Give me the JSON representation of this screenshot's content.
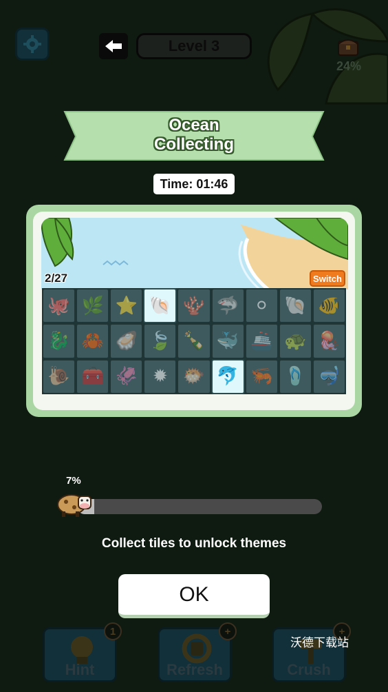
{
  "header": {
    "level_label": "Level 3",
    "chest_percent": "24%"
  },
  "modal": {
    "title_line1": "Ocean",
    "title_line2": "Collecting",
    "timer": "Time: 01:46",
    "collected_count": "2/27",
    "switch_label": "Switch",
    "tiles": [
      {
        "icon": "octopus-icon",
        "glyph": "🐙",
        "collected": false
      },
      {
        "icon": "seaweed-icon",
        "glyph": "🌿",
        "collected": false
      },
      {
        "icon": "starfish-icon",
        "glyph": "⭐",
        "collected": false
      },
      {
        "icon": "scallop-shell-icon",
        "glyph": "🐚",
        "collected": true
      },
      {
        "icon": "coral-icon",
        "glyph": "🪸",
        "collected": false
      },
      {
        "icon": "manta-ray-icon",
        "glyph": "🦈",
        "collected": false
      },
      {
        "icon": "pearl-icon",
        "glyph": "⚪",
        "collected": false
      },
      {
        "icon": "conch-shell-icon",
        "glyph": "🐚",
        "collected": false
      },
      {
        "icon": "clownfish-icon",
        "glyph": "🐠",
        "collected": false
      },
      {
        "icon": "seahorse-icon",
        "glyph": "🐉",
        "collected": false
      },
      {
        "icon": "crab-icon",
        "glyph": "🦀",
        "collected": false
      },
      {
        "icon": "oyster-pearl-icon",
        "glyph": "🦪",
        "collected": false
      },
      {
        "icon": "sea-glass-icon",
        "glyph": "🍃",
        "collected": false
      },
      {
        "icon": "message-bottle-icon",
        "glyph": "🍾",
        "collected": false
      },
      {
        "icon": "whale-icon",
        "glyph": "🐳",
        "collected": false
      },
      {
        "icon": "submarine-icon",
        "glyph": "🚢",
        "collected": false
      },
      {
        "icon": "turtle-icon",
        "glyph": "🐢",
        "collected": false
      },
      {
        "icon": "jellyfish-icon",
        "glyph": "🪼",
        "collected": false
      },
      {
        "icon": "hermit-crab-icon",
        "glyph": "🐌",
        "collected": false
      },
      {
        "icon": "treasure-chest-icon",
        "glyph": "🧰",
        "collected": false
      },
      {
        "icon": "squid-icon",
        "glyph": "🦑",
        "collected": false
      },
      {
        "icon": "sea-urchin-icon",
        "glyph": "✹",
        "collected": false
      },
      {
        "icon": "pufferfish-icon",
        "glyph": "🐡",
        "collected": false
      },
      {
        "icon": "dolphin-icon",
        "glyph": "🐬",
        "collected": true
      },
      {
        "icon": "shrimp-icon",
        "glyph": "🦐",
        "collected": false
      },
      {
        "icon": "flipper-icon",
        "glyph": "🩴",
        "collected": false
      },
      {
        "icon": "snorkel-mask-icon",
        "glyph": "🤿",
        "collected": false
      }
    ],
    "progress_percent_label": "7%",
    "progress_fraction": 0.07,
    "message": "Collect tiles to unlock themes",
    "ok_label": "OK"
  },
  "bottom_bar": {
    "hint_label": "Hint",
    "hint_count": "1",
    "refresh_label": "Refresh",
    "crush_label": "Crush",
    "add_symbol": "+"
  },
  "watermark": "沃德下载站",
  "colors": {
    "ribbon": "#b5e0ae",
    "card": "#a9d6a2",
    "switch": "#f07a1e",
    "tile_locked": "#3e5a5e",
    "tile_collected": "#def8fb"
  }
}
